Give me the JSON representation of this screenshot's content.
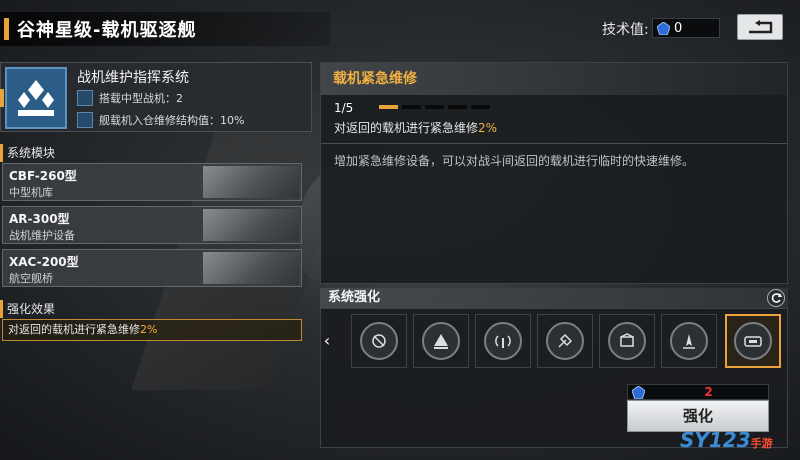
{
  "header": {
    "title": "谷神星级-载机驱逐舰",
    "tech_label": "技术值:",
    "tech_value": "0",
    "back_icon": "back-arrow-icon"
  },
  "system": {
    "name": "战机维护指挥系统",
    "line1": "搭载中型战机：2",
    "line2": "舰载机入仓维修结构值：10%"
  },
  "modules_label": "系统模块",
  "modules": [
    {
      "name": "CBF-260型",
      "desc": "中型机库"
    },
    {
      "name": "AR-300型",
      "desc": "战机维护设备"
    },
    {
      "name": "XAC-200型",
      "desc": "航空舰桥"
    }
  ],
  "effect": {
    "label": "强化效果",
    "text": "对返回的载机进行紧急维修",
    "value": "2%"
  },
  "detail": {
    "title": "载机紧急维修",
    "level": "1/5",
    "level_current": 1,
    "level_max": 5,
    "effect_text": "对返回的载机进行紧急维修",
    "effect_value": "2%",
    "description": "增加紧急维修设备，可以对战斗间返回的载机进行临时的快速维修。"
  },
  "enhance": {
    "label": "系统强化",
    "slots": [
      "slot-1",
      "slot-2",
      "slot-3",
      "slot-4",
      "slot-5",
      "slot-6",
      "slot-7"
    ],
    "selected_index": 6,
    "cost": "2",
    "button": "强化"
  },
  "watermark": {
    "main": "SY123",
    "sub": "手游\n.net"
  },
  "colors": {
    "accent": "#e8a33a",
    "cost": "#ee3333",
    "link": "#3a8cd6"
  }
}
